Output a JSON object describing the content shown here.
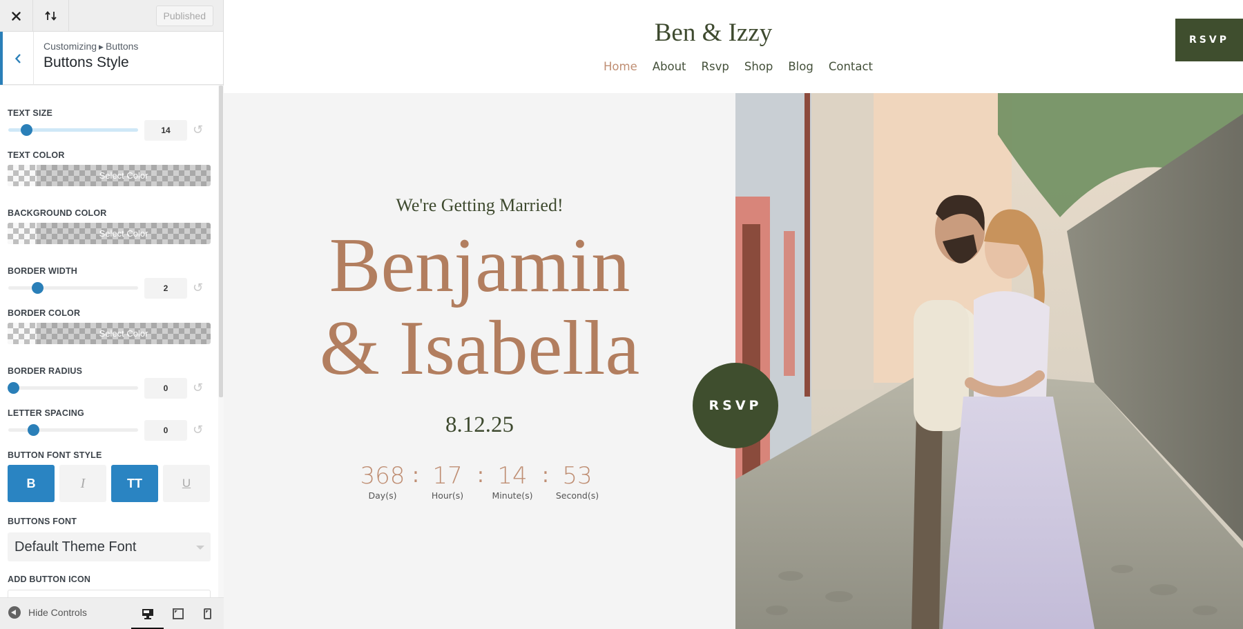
{
  "sidebar": {
    "topbar": {
      "close_icon": "close-icon",
      "sort_icon": "arrows-up-down-icon",
      "publish_label": "Published"
    },
    "section": {
      "breadcrumb_root": "Customizing",
      "breadcrumb_parent": "Buttons",
      "title": "Buttons Style"
    },
    "controls": {
      "text_size": {
        "label": "Text Size",
        "value": "14",
        "slider_fraction": 0.14
      },
      "text_color": {
        "label": "Text Color",
        "button": "Select Color"
      },
      "background_color": {
        "label": "Background Color",
        "button": "Select Color"
      },
      "border_width": {
        "label": "Border Width",
        "value": "2",
        "slider_fraction": 0.2
      },
      "border_color": {
        "label": "Border Color",
        "button": "Select Color"
      },
      "border_radius": {
        "label": "Border Radius",
        "value": "0",
        "slider_fraction": 0.0
      },
      "letter_spacing": {
        "label": "Letter Spacing",
        "value": "0",
        "slider_fraction": 0.15
      },
      "font_style": {
        "label": "Button Font Style",
        "options": [
          {
            "glyph": "B",
            "name": "bold",
            "active": true
          },
          {
            "glyph": "I",
            "name": "italic",
            "active": false
          },
          {
            "glyph": "TT",
            "name": "uppercase",
            "active": true
          },
          {
            "glyph": "U",
            "name": "underline",
            "active": false
          }
        ]
      },
      "buttons_font": {
        "label": "Buttons Font",
        "selected": "Default Theme Font"
      },
      "add_button_icon": {
        "label": "Add Button Icon"
      }
    },
    "footer": {
      "hide_controls_label": "Hide Controls",
      "devices": [
        "desktop",
        "tablet",
        "mobile"
      ],
      "active_device": "desktop"
    }
  },
  "preview": {
    "site_title": "Ben & Izzy",
    "nav": [
      "Home",
      "About",
      "Rsvp",
      "Shop",
      "Blog",
      "Contact"
    ],
    "nav_current": "Home",
    "header_button": "RSVP",
    "hero": {
      "tagline": "We're Getting Married!",
      "name_line1": "Benjamin",
      "name_line2": "& Isabella",
      "date": "8.12.25",
      "countdown": [
        {
          "value": "368",
          "label": "Day(s)"
        },
        {
          "value": "17",
          "label": "Hour(s)"
        },
        {
          "value": "14",
          "label": "Minute(s)"
        },
        {
          "value": "53",
          "label": "Second(s)"
        }
      ],
      "separator": ":",
      "circle_button": "RSVP",
      "photo": "couple embracing on cobblestone alley"
    },
    "colors": {
      "accent_green": "#3f4e2e",
      "accent_copper": "#b27e5f",
      "customizer_blue": "#2a84c2"
    }
  }
}
